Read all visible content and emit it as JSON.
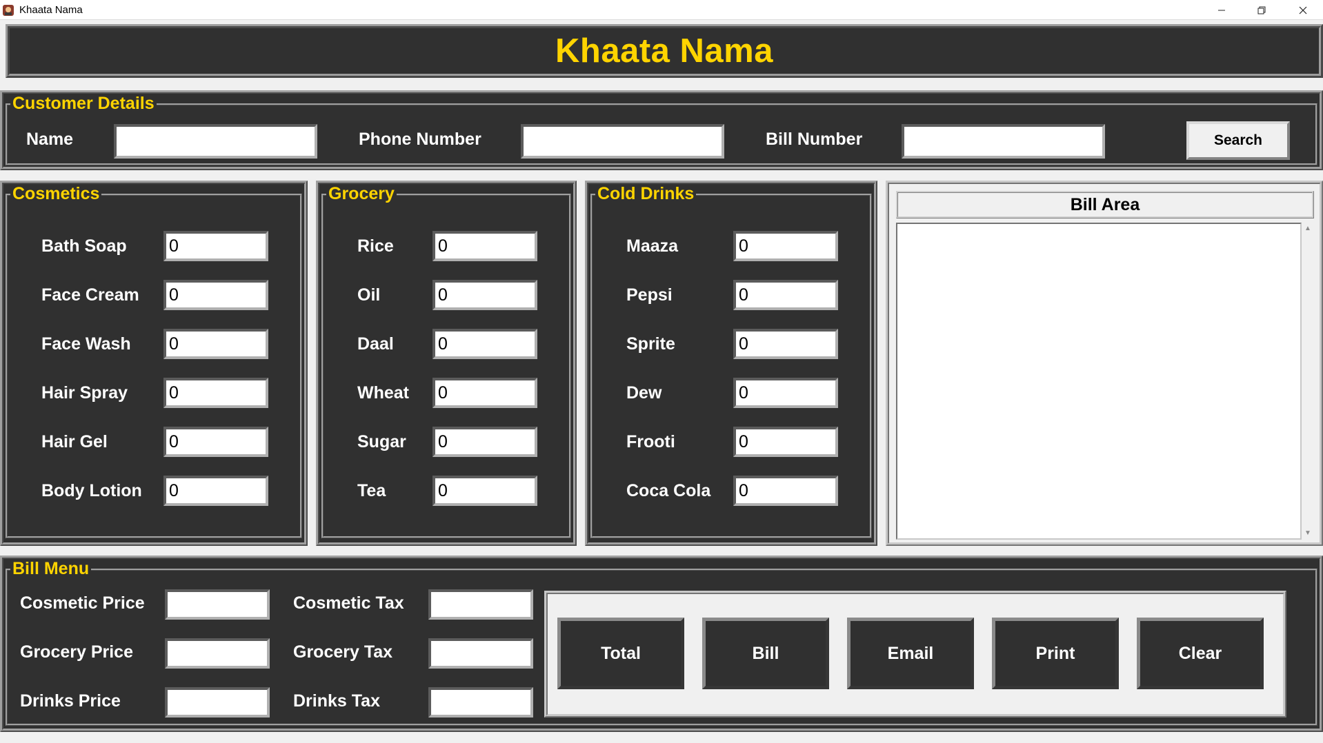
{
  "window": {
    "title": "Khaata Nama"
  },
  "header": {
    "title": "Khaata Nama"
  },
  "customer": {
    "legend": "Customer Details",
    "name_label": "Name",
    "name_value": "",
    "phone_label": "Phone Number",
    "phone_value": "",
    "bill_label": "Bill Number",
    "bill_value": "",
    "search_label": "Search"
  },
  "cosmetics": {
    "legend": "Cosmetics",
    "items": [
      {
        "label": "Bath Soap",
        "value": "0"
      },
      {
        "label": "Face Cream",
        "value": "0"
      },
      {
        "label": "Face Wash",
        "value": "0"
      },
      {
        "label": "Hair Spray",
        "value": "0"
      },
      {
        "label": "Hair Gel",
        "value": "0"
      },
      {
        "label": "Body Lotion",
        "value": "0"
      }
    ]
  },
  "grocery": {
    "legend": "Grocery",
    "items": [
      {
        "label": "Rice",
        "value": "0"
      },
      {
        "label": "Oil",
        "value": "0"
      },
      {
        "label": "Daal",
        "value": "0"
      },
      {
        "label": "Wheat",
        "value": "0"
      },
      {
        "label": "Sugar",
        "value": "0"
      },
      {
        "label": "Tea",
        "value": "0"
      }
    ]
  },
  "drinks": {
    "legend": "Cold Drinks",
    "items": [
      {
        "label": "Maaza",
        "value": "0"
      },
      {
        "label": "Pepsi",
        "value": "0"
      },
      {
        "label": "Sprite",
        "value": "0"
      },
      {
        "label": "Dew",
        "value": "0"
      },
      {
        "label": "Frooti",
        "value": "0"
      },
      {
        "label": "Coca Cola",
        "value": "0"
      }
    ]
  },
  "bill_area": {
    "title": "Bill Area",
    "content": ""
  },
  "bill_menu": {
    "legend": "Bill Menu",
    "cosmetic_price_label": "Cosmetic Price",
    "cosmetic_price_value": "",
    "grocery_price_label": "Grocery Price",
    "grocery_price_value": "",
    "drinks_price_label": "Drinks Price",
    "drinks_price_value": "",
    "cosmetic_tax_label": "Cosmetic Tax",
    "cosmetic_tax_value": "",
    "grocery_tax_label": "Grocery Tax",
    "grocery_tax_value": "",
    "drinks_tax_label": "Drinks Tax",
    "drinks_tax_value": "",
    "buttons": {
      "total": "Total",
      "bill": "Bill",
      "email": "Email",
      "print": "Print",
      "clear": "Clear"
    }
  },
  "colors": {
    "panel": "#303030",
    "accent": "#ffd400",
    "label": "#ffffff"
  }
}
